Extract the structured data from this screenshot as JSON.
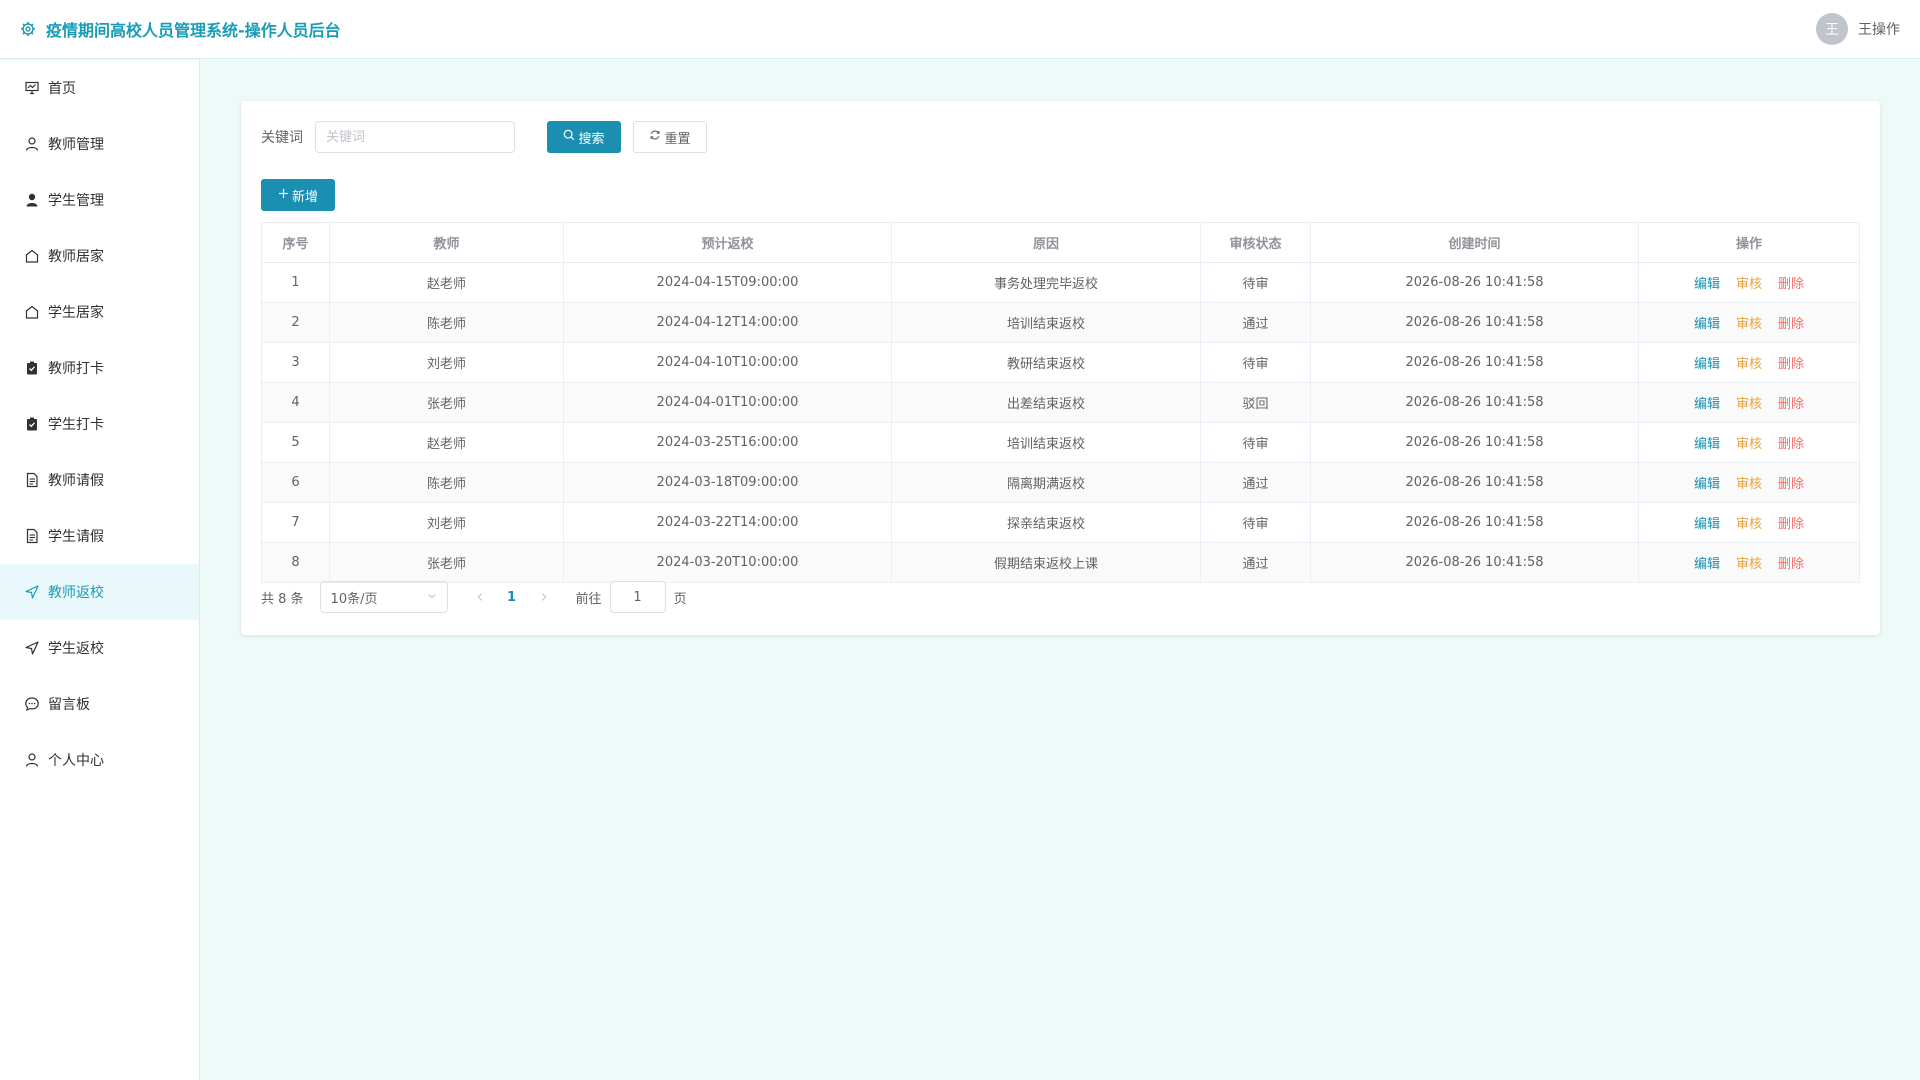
{
  "header": {
    "title": "疫情期间高校人员管理系统-操作人员后台",
    "avatar_text": "王",
    "username": "王操作"
  },
  "sidebar": {
    "items": [
      {
        "label": "首页",
        "icon": "dashboard-icon"
      },
      {
        "label": "教师管理",
        "icon": "user-outline-icon"
      },
      {
        "label": "学生管理",
        "icon": "user-solid-icon"
      },
      {
        "label": "教师居家",
        "icon": "house-icon"
      },
      {
        "label": "学生居家",
        "icon": "house-icon"
      },
      {
        "label": "教师打卡",
        "icon": "checked-clipboard-icon"
      },
      {
        "label": "学生打卡",
        "icon": "checked-clipboard-icon"
      },
      {
        "label": "教师请假",
        "icon": "document-icon"
      },
      {
        "label": "学生请假",
        "icon": "document-icon"
      },
      {
        "label": "教师返校",
        "icon": "position-arrow-icon"
      },
      {
        "label": "学生返校",
        "icon": "position-arrow-icon"
      },
      {
        "label": "留言板",
        "icon": "chat-icon"
      },
      {
        "label": "个人中心",
        "icon": "user-outline-icon"
      }
    ],
    "active_index": 9
  },
  "search": {
    "label": "关键词",
    "placeholder": "关键词",
    "value": "",
    "search_button": "搜索",
    "reset_button": "重置"
  },
  "toolbar": {
    "add_button": "新增"
  },
  "table": {
    "columns": [
      "序号",
      "教师",
      "预计返校",
      "原因",
      "审核状态",
      "创建时间",
      "操作"
    ],
    "rows": [
      {
        "index": "1",
        "teacher": "赵老师",
        "return_time": "2024-04-15T09:00:00",
        "reason": "事务处理完毕返校",
        "status": "待审",
        "created": "2026-08-26 10:41:58"
      },
      {
        "index": "2",
        "teacher": "陈老师",
        "return_time": "2024-04-12T14:00:00",
        "reason": "培训结束返校",
        "status": "通过",
        "created": "2026-08-26 10:41:58"
      },
      {
        "index": "3",
        "teacher": "刘老师",
        "return_time": "2024-04-10T10:00:00",
        "reason": "教研结束返校",
        "status": "待审",
        "created": "2026-08-26 10:41:58"
      },
      {
        "index": "4",
        "teacher": "张老师",
        "return_time": "2024-04-01T10:00:00",
        "reason": "出差结束返校",
        "status": "驳回",
        "created": "2026-08-26 10:41:58"
      },
      {
        "index": "5",
        "teacher": "赵老师",
        "return_time": "2024-03-25T16:00:00",
        "reason": "培训结束返校",
        "status": "待审",
        "created": "2026-08-26 10:41:58"
      },
      {
        "index": "6",
        "teacher": "陈老师",
        "return_time": "2024-03-18T09:00:00",
        "reason": "隔离期满返校",
        "status": "通过",
        "created": "2026-08-26 10:41:58"
      },
      {
        "index": "7",
        "teacher": "刘老师",
        "return_time": "2024-03-22T14:00:00",
        "reason": "探亲结束返校",
        "status": "待审",
        "created": "2026-08-26 10:41:58"
      },
      {
        "index": "8",
        "teacher": "张老师",
        "return_time": "2024-03-20T10:00:00",
        "reason": "假期结束返校上课",
        "status": "通过",
        "created": "2026-08-26 10:41:58"
      }
    ],
    "actions": {
      "edit": "编辑",
      "audit": "审核",
      "delete": "删除"
    }
  },
  "pagination": {
    "total_text": "共 8 条",
    "page_size": "10条/页",
    "current_page": "1",
    "goto_label": "前往",
    "goto_value": "1",
    "page_suffix": "页"
  },
  "colors": {
    "accent": "#1a8fb1",
    "title": "#1a9cb6",
    "warning": "#e6a23c",
    "danger": "#f56c6c",
    "background": "#eefaf8"
  }
}
